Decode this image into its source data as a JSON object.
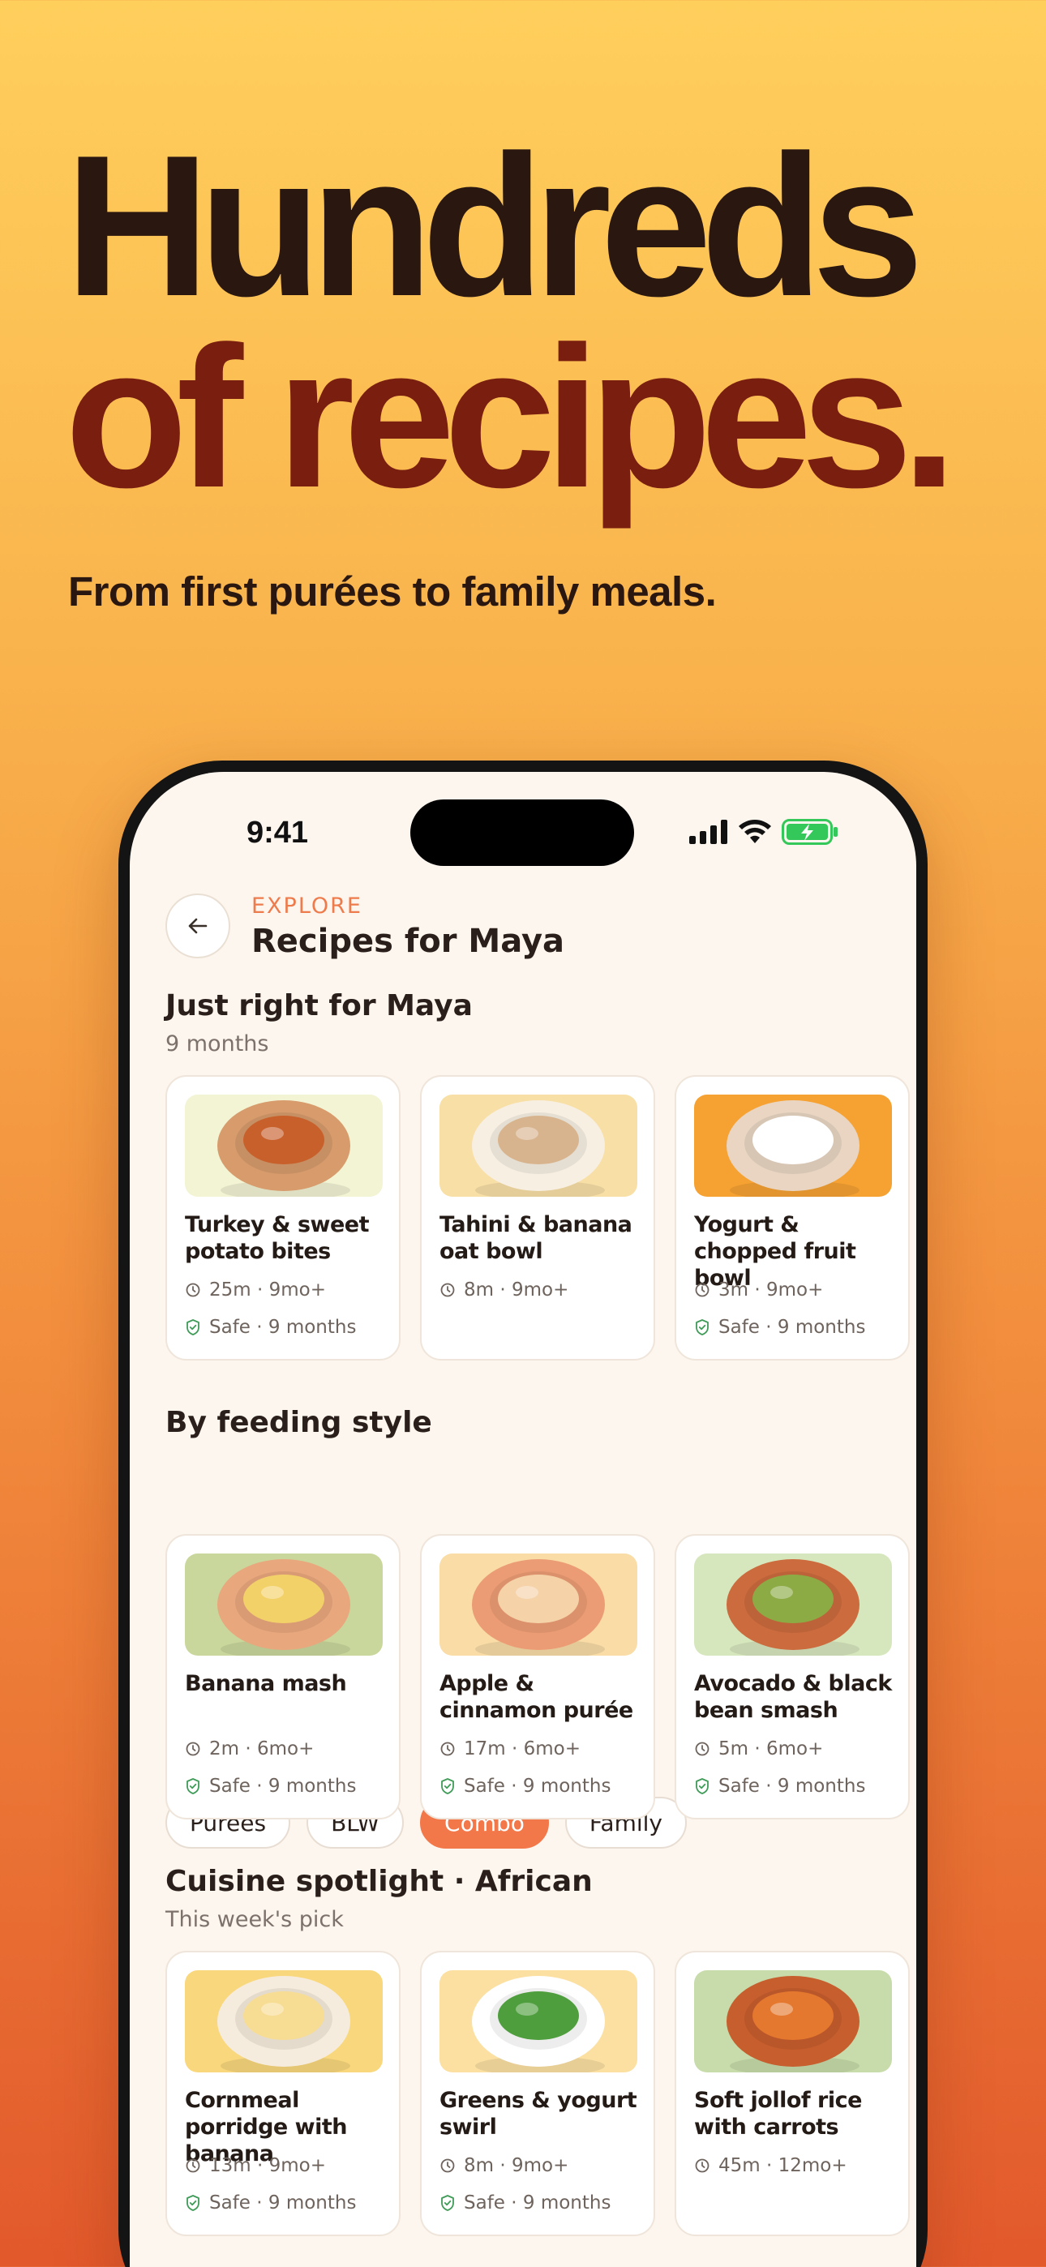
{
  "hero": {
    "line1": "Hundreds",
    "line2": "of recipes.",
    "subtitle": "From first purées to family meals."
  },
  "status_bar": {
    "time": "9:41"
  },
  "header": {
    "eyebrow": "EXPLORE",
    "title": "Recipes for Maya"
  },
  "sections": [
    {
      "title": "Just right for Maya",
      "subtitle": "9 months",
      "cards": [
        {
          "name": "Turkey & sweet potato bites",
          "meta": "25m · 9mo+",
          "safe": "Safe · 9 months",
          "img_bg": "#f2f4d4",
          "plate": "#d79b6c",
          "food": "#c8602c"
        },
        {
          "name": "Tahini & banana oat bowl",
          "meta": "8m · 9mo+",
          "safe": "",
          "img_bg": "#f8dfa6",
          "plate": "#f7efe2",
          "food": "#d8b48e"
        },
        {
          "name": "Yogurt & chopped fruit bowl",
          "meta": "3m · 9mo+",
          "safe": "Safe · 9 months",
          "img_bg": "#f6a232",
          "plate": "#e9d5c2",
          "food": "#ffffff"
        }
      ]
    },
    {
      "title": "By feeding style",
      "chips": [
        {
          "label": "Purées",
          "active": false
        },
        {
          "label": "BLW",
          "active": false
        },
        {
          "label": "Combo",
          "active": true
        },
        {
          "label": "Family",
          "active": false
        }
      ],
      "cards": [
        {
          "name": "Banana mash",
          "meta": "2m · 6mo+",
          "safe": "Safe · 9 months",
          "img_bg": "#c9d79c",
          "plate": "#e9a77d",
          "food": "#f3d169"
        },
        {
          "name": "Apple & cinnamon purée",
          "meta": "17m · 6mo+",
          "safe": "Safe · 9 months",
          "img_bg": "#f9dca6",
          "plate": "#ec9c74",
          "food": "#f5d2a8"
        },
        {
          "name": "Avocado & black bean smash",
          "meta": "5m · 6mo+",
          "safe": "Safe · 9 months",
          "img_bg": "#d6e7bd",
          "plate": "#cc6b3e",
          "food": "#8cab45"
        }
      ]
    },
    {
      "title": "Cuisine spotlight · African",
      "subtitle": "This week's pick",
      "cards": [
        {
          "name": "Cornmeal porridge with banana",
          "meta": "13m · 9mo+",
          "safe": "Safe · 9 months",
          "img_bg": "#f9d77c",
          "plate": "#f6ecdd",
          "food": "#f7dc93"
        },
        {
          "name": "Greens & yogurt swirl",
          "meta": "8m · 9mo+",
          "safe": "Safe · 9 months",
          "img_bg": "#fbe0a2",
          "plate": "#ffffff",
          "food": "#4f9e3e"
        },
        {
          "name": "Soft jollof rice with carrots",
          "meta": "45m · 12mo+",
          "safe": "",
          "img_bg": "#c7dcaa",
          "plate": "#c75e2e",
          "food": "#e5782f"
        }
      ]
    }
  ],
  "icons": {
    "back": "arrow-left-icon",
    "clock": "clock-icon",
    "shield": "shield-check-icon"
  },
  "colors": {
    "accent": "#f2784a",
    "eyebrow": "#ee7b4c",
    "headline_dark": "#2a1710",
    "headline_red": "#7a1f10",
    "safe_green": "#3f9b58",
    "battery_green": "#34c759"
  }
}
